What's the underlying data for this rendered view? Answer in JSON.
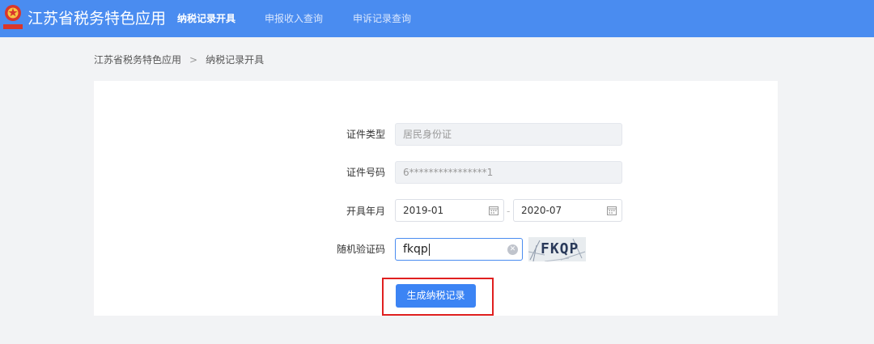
{
  "header": {
    "app_title": "江苏省税务特色应用",
    "tabs": [
      {
        "label": "纳税记录开具",
        "active": true
      },
      {
        "label": "申报收入查询",
        "active": false
      },
      {
        "label": "申诉记录查询",
        "active": false
      }
    ],
    "bar_color": "#4a8cf0"
  },
  "breadcrumb": {
    "items": [
      "江苏省税务特色应用",
      "纳税记录开具"
    ],
    "separator": ">"
  },
  "form": {
    "id_type": {
      "label": "证件类型",
      "value": "居民身份证"
    },
    "id_number": {
      "label": "证件号码",
      "value": "6****************1"
    },
    "period": {
      "label": "开具年月",
      "start": "2019-01",
      "end": "2020-07",
      "separator": "-"
    },
    "captcha": {
      "label": "随机验证码",
      "value": "fkqp",
      "image_text": "FKQP"
    },
    "submit_label": "生成纳税记录"
  },
  "colors": {
    "accent": "#3c84f4",
    "highlight": "#e02020"
  },
  "icons": [
    "emblem-icon",
    "calendar-icon",
    "clear-icon",
    "chevron-right-icon"
  ]
}
